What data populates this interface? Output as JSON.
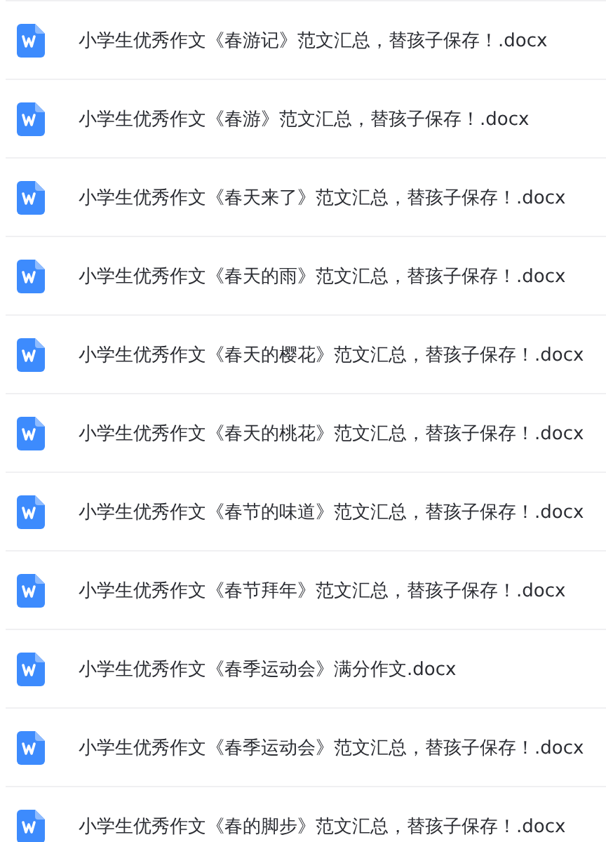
{
  "files": [
    {
      "name": "小学生优秀作文《春游记》范文汇总，替孩子保存！.docx"
    },
    {
      "name": "小学生优秀作文《春游》范文汇总，替孩子保存！.docx"
    },
    {
      "name": "小学生优秀作文《春天来了》范文汇总，替孩子保存！.docx"
    },
    {
      "name": "小学生优秀作文《春天的雨》范文汇总，替孩子保存！.docx"
    },
    {
      "name": "小学生优秀作文《春天的樱花》范文汇总，替孩子保存！.docx"
    },
    {
      "name": "小学生优秀作文《春天的桃花》范文汇总，替孩子保存！.docx"
    },
    {
      "name": "小学生优秀作文《春节的味道》范文汇总，替孩子保存！.docx"
    },
    {
      "name": "小学生优秀作文《春节拜年》范文汇总，替孩子保存！.docx"
    },
    {
      "name": "小学生优秀作文《春季运动会》满分作文.docx"
    },
    {
      "name": "小学生优秀作文《春季运动会》范文汇总，替孩子保存！.docx"
    },
    {
      "name": "小学生优秀作文《春的脚步》范文汇总，替孩子保存！.docx"
    }
  ]
}
